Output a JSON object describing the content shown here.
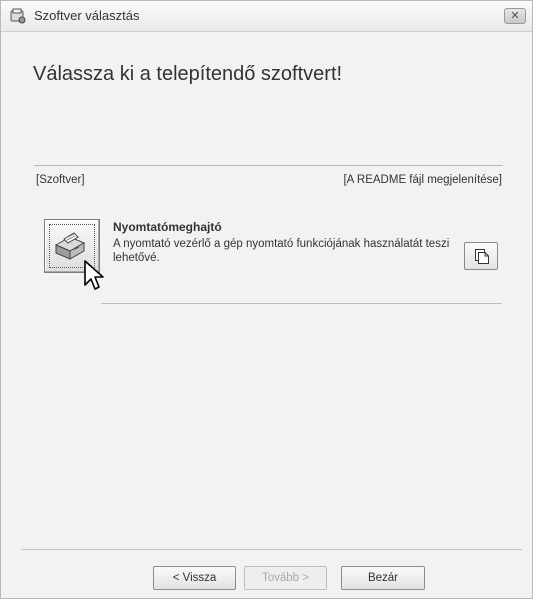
{
  "window": {
    "title": "Szoftver választás",
    "close_label": "✕"
  },
  "heading": "Válassza ki a telepítendő szoftvert!",
  "columns": {
    "left": "[Szoftver]",
    "right": "[A README fájl megjelenítése]"
  },
  "software_items": [
    {
      "name": "Nyomtatómeghajtó",
      "description": "A nyomtató vezérlő a gép nyomtató funkciójának használatát teszi lehetővé.",
      "icon": "printer-icon",
      "readme_icon": "document-icon"
    }
  ],
  "buttons": {
    "back": "< Vissza",
    "next": "Tovább >",
    "close": "Bezár"
  },
  "colors": {
    "window_background": "#f2f2f2",
    "text": "#333333",
    "disabled_text": "#a8a8a8"
  }
}
